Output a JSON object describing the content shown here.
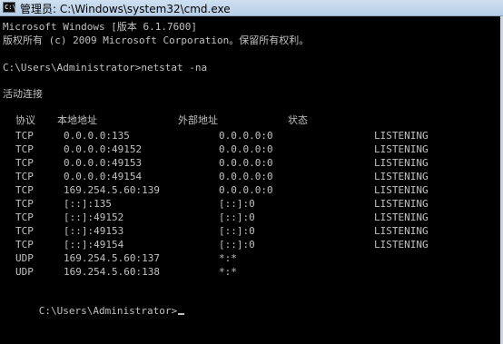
{
  "window": {
    "title": "管理员: C:\\Windows\\system32\\cmd.exe",
    "icon_text": "C:\\"
  },
  "console": {
    "version_line": "Microsoft Windows [版本 6.1.7600]",
    "copyright_line": "版权所有 (c) 2009 Microsoft Corporation。保留所有权利。",
    "command_line": "C:\\Users\\Administrator>netstat -na",
    "section_title": "活动连接",
    "headers": {
      "proto": "协议",
      "local": "本地地址",
      "foreign": "外部地址",
      "state": "状态"
    },
    "rows": [
      {
        "proto": "TCP",
        "local": "0.0.0.0:135",
        "foreign": "0.0.0.0:0",
        "state": "LISTENING"
      },
      {
        "proto": "TCP",
        "local": "0.0.0.0:49152",
        "foreign": "0.0.0.0:0",
        "state": "LISTENING"
      },
      {
        "proto": "TCP",
        "local": "0.0.0.0:49153",
        "foreign": "0.0.0.0:0",
        "state": "LISTENING"
      },
      {
        "proto": "TCP",
        "local": "0.0.0.0:49154",
        "foreign": "0.0.0.0:0",
        "state": "LISTENING"
      },
      {
        "proto": "TCP",
        "local": "169.254.5.60:139",
        "foreign": "0.0.0.0:0",
        "state": "LISTENING"
      },
      {
        "proto": "TCP",
        "local": "[::]:135",
        "foreign": "[::]:0",
        "state": "LISTENING"
      },
      {
        "proto": "TCP",
        "local": "[::]:49152",
        "foreign": "[::]:0",
        "state": "LISTENING"
      },
      {
        "proto": "TCP",
        "local": "[::]:49153",
        "foreign": "[::]:0",
        "state": "LISTENING"
      },
      {
        "proto": "TCP",
        "local": "[::]:49154",
        "foreign": "[::]:0",
        "state": "LISTENING"
      },
      {
        "proto": "UDP",
        "local": "169.254.5.60:137",
        "foreign": "*:*",
        "state": ""
      },
      {
        "proto": "UDP",
        "local": "169.254.5.60:138",
        "foreign": "*:*",
        "state": ""
      }
    ],
    "prompt": "C:\\Users\\Administrator>"
  },
  "colors": {
    "text": "#c0c0c0",
    "background": "#000000"
  }
}
